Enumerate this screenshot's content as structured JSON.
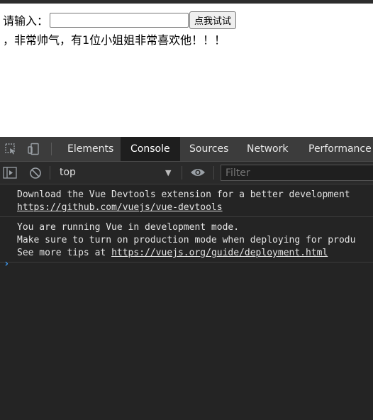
{
  "page": {
    "input_label": "请输入：",
    "input_value": "",
    "button_label": "点我试试",
    "message": "，非常帅气，有1位小姐姐非常喜欢他！！！"
  },
  "devtools": {
    "tabs": [
      "Elements",
      "Console",
      "Sources",
      "Network",
      "Performance"
    ],
    "active_tab": "Console",
    "context": "top",
    "filter_placeholder": "Filter",
    "messages": [
      {
        "line1": "Download the Vue Devtools extension for a better development",
        "link": "https://github.com/vuejs/vue-devtools"
      },
      {
        "line1": "You are running Vue in development mode.",
        "line2": "Make sure to turn on production mode when deploying for produ",
        "line3_prefix": "See more tips at ",
        "link": "https://vuejs.org/guide/deployment.html"
      }
    ],
    "prompt_symbol": "›"
  },
  "colors": {
    "devtools_bg": "#242424",
    "tabbar_bg": "#3c3c3c",
    "active_tab_bg": "#1e1e1e",
    "prompt": "#3d9cf6"
  }
}
